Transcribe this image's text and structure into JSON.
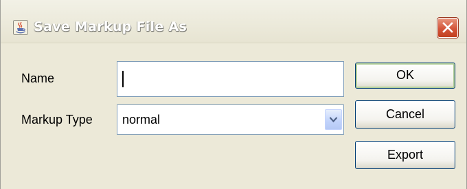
{
  "window": {
    "title": "Save Markup File As",
    "app_icon": "java-cup-icon",
    "close_icon": "close-icon"
  },
  "form": {
    "name_label": "Name",
    "name_value": "",
    "markup_type_label": "Markup Type",
    "markup_type_value": "normal",
    "dropdown_icon": "chevron-down-icon"
  },
  "buttons": {
    "ok": "OK",
    "cancel": "Cancel",
    "export": "Export"
  },
  "colors": {
    "close_button": "#d4553a",
    "ok_focus_ring": "#b4cf9a",
    "field_border": "#7f9db9"
  }
}
